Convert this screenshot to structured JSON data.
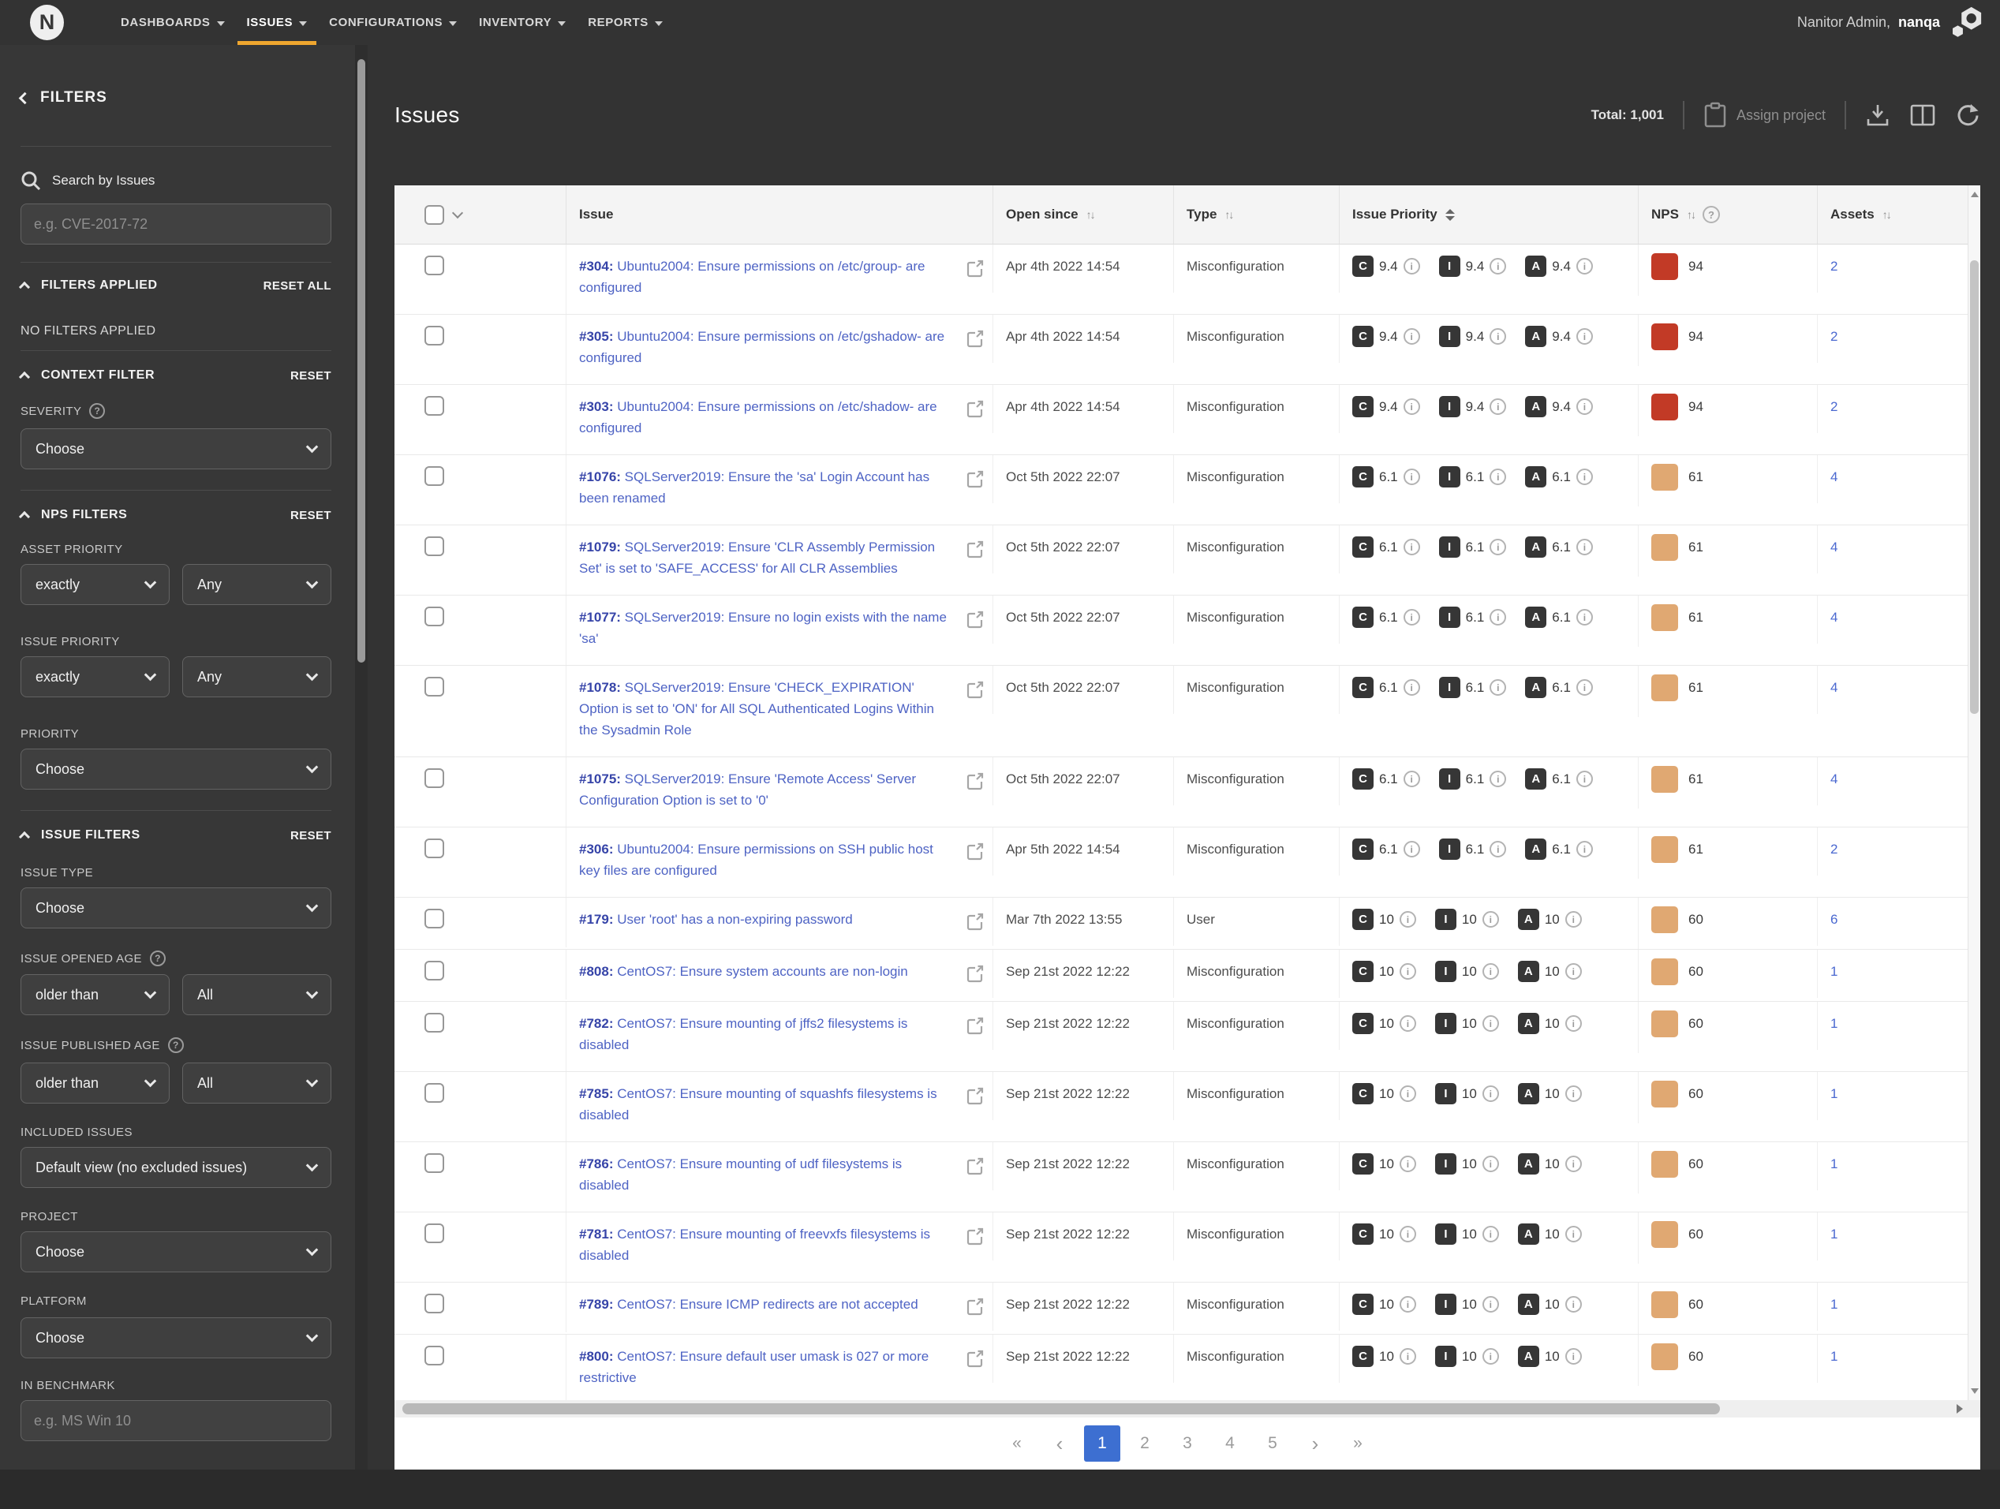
{
  "colors": {
    "accent": "#efa62f",
    "nps_high": "#c23a26",
    "nps_medium": "#e0a872",
    "active_page": "#3d6fd1",
    "link": "#4e63c4"
  },
  "brand": {
    "logo_letter": "N",
    "user_label": "Nanitor Admin,",
    "user_name": "nanqa"
  },
  "nav": {
    "items": [
      {
        "label": "DASHBOARDS",
        "active": false
      },
      {
        "label": "ISSUES",
        "active": true
      },
      {
        "label": "CONFIGURATIONS",
        "active": false
      },
      {
        "label": "INVENTORY",
        "active": false
      },
      {
        "label": "REPORTS",
        "active": false
      }
    ]
  },
  "sidebar": {
    "title": "FILTERS",
    "search_label": "Search by Issues",
    "search_placeholder": "e.g. CVE-2017-72",
    "filters_applied": {
      "title": "FILTERS APPLIED",
      "action": "RESET ALL",
      "empty": "NO FILTERS APPLIED"
    },
    "context_filter": {
      "title": "CONTEXT FILTER",
      "action": "RESET",
      "severity_label": "SEVERITY",
      "severity_value": "Choose"
    },
    "nps_filters": {
      "title": "NPS FILTERS",
      "action": "RESET",
      "asset_priority_label": "ASSET PRIORITY",
      "asset_priority_op": "exactly",
      "asset_priority_value": "Any",
      "issue_priority_label": "ISSUE PRIORITY",
      "issue_priority_op": "exactly",
      "issue_priority_value": "Any",
      "priority_label": "PRIORITY",
      "priority_value": "Choose"
    },
    "issue_filters": {
      "title": "ISSUE FILTERS",
      "action": "RESET",
      "issue_type_label": "ISSUE TYPE",
      "issue_type_value": "Choose",
      "opened_age_label": "ISSUE OPENED AGE",
      "opened_age_op": "older than",
      "opened_age_value": "All",
      "published_age_label": "ISSUE PUBLISHED AGE",
      "published_age_op": "older than",
      "published_age_value": "All",
      "included_label": "INCLUDED ISSUES",
      "included_value": "Default view (no excluded issues)",
      "project_label": "PROJECT",
      "project_value": "Choose",
      "platform_label": "PLATFORM",
      "platform_value": "Choose",
      "benchmark_label": "IN BENCHMARK",
      "benchmark_placeholder": "e.g. MS Win 10"
    }
  },
  "header": {
    "title": "Issues",
    "total_label": "Total: 1,001",
    "assign_label": "Assign project"
  },
  "table": {
    "columns": {
      "issue": "Issue",
      "open_since": "Open since",
      "type": "Type",
      "issue_priority": "Issue Priority",
      "nps": "NPS",
      "assets": "Assets"
    },
    "priority_letters": [
      "C",
      "I",
      "A"
    ],
    "rows": [
      {
        "id": "#304:",
        "title": "Ubuntu2004: Ensure permissions on /etc/group- are configured",
        "open_since": "Apr 4th 2022 14:54",
        "type": "Misconfiguration",
        "priority": "9.4",
        "nps": "94",
        "nps_level": "high",
        "assets": "2"
      },
      {
        "id": "#305:",
        "title": "Ubuntu2004: Ensure permissions on /etc/gshadow- are configured",
        "open_since": "Apr 4th 2022 14:54",
        "type": "Misconfiguration",
        "priority": "9.4",
        "nps": "94",
        "nps_level": "high",
        "assets": "2"
      },
      {
        "id": "#303:",
        "title": "Ubuntu2004: Ensure permissions on /etc/shadow- are configured",
        "open_since": "Apr 4th 2022 14:54",
        "type": "Misconfiguration",
        "priority": "9.4",
        "nps": "94",
        "nps_level": "high",
        "assets": "2"
      },
      {
        "id": "#1076:",
        "title": "SQLServer2019: Ensure the 'sa' Login Account has been renamed",
        "open_since": "Oct 5th 2022 22:07",
        "type": "Misconfiguration",
        "priority": "6.1",
        "nps": "61",
        "nps_level": "medium",
        "assets": "4"
      },
      {
        "id": "#1079:",
        "title": "SQLServer2019: Ensure 'CLR Assembly Permission Set' is set to 'SAFE_ACCESS' for All CLR Assemblies",
        "open_since": "Oct 5th 2022 22:07",
        "type": "Misconfiguration",
        "priority": "6.1",
        "nps": "61",
        "nps_level": "medium",
        "assets": "4"
      },
      {
        "id": "#1077:",
        "title": "SQLServer2019: Ensure no login exists with the name 'sa'",
        "open_since": "Oct 5th 2022 22:07",
        "type": "Misconfiguration",
        "priority": "6.1",
        "nps": "61",
        "nps_level": "medium",
        "assets": "4"
      },
      {
        "id": "#1078:",
        "title": "SQLServer2019: Ensure 'CHECK_EXPIRATION' Option is set to 'ON' for All SQL Authenticated Logins Within the Sysadmin Role",
        "open_since": "Oct 5th 2022 22:07",
        "type": "Misconfiguration",
        "priority": "6.1",
        "nps": "61",
        "nps_level": "medium",
        "assets": "4"
      },
      {
        "id": "#1075:",
        "title": "SQLServer2019: Ensure 'Remote Access' Server Configuration Option is set to '0'",
        "open_since": "Oct 5th 2022 22:07",
        "type": "Misconfiguration",
        "priority": "6.1",
        "nps": "61",
        "nps_level": "medium",
        "assets": "4"
      },
      {
        "id": "#306:",
        "title": "Ubuntu2004: Ensure permissions on SSH public host key files are configured",
        "open_since": "Apr 5th 2022 14:54",
        "type": "Misconfiguration",
        "priority": "6.1",
        "nps": "61",
        "nps_level": "medium",
        "assets": "2"
      },
      {
        "id": "#179:",
        "title": "User 'root' has a non-expiring password",
        "open_since": "Mar 7th 2022 13:55",
        "type": "User",
        "priority": "10",
        "nps": "60",
        "nps_level": "medium",
        "assets": "6"
      },
      {
        "id": "#808:",
        "title": "CentOS7: Ensure system accounts are non-login",
        "open_since": "Sep 21st 2022 12:22",
        "type": "Misconfiguration",
        "priority": "10",
        "nps": "60",
        "nps_level": "medium",
        "assets": "1"
      },
      {
        "id": "#782:",
        "title": "CentOS7: Ensure mounting of jffs2 filesystems is disabled",
        "open_since": "Sep 21st 2022 12:22",
        "type": "Misconfiguration",
        "priority": "10",
        "nps": "60",
        "nps_level": "medium",
        "assets": "1"
      },
      {
        "id": "#785:",
        "title": "CentOS7: Ensure mounting of squashfs filesystems is disabled",
        "open_since": "Sep 21st 2022 12:22",
        "type": "Misconfiguration",
        "priority": "10",
        "nps": "60",
        "nps_level": "medium",
        "assets": "1"
      },
      {
        "id": "#786:",
        "title": "CentOS7: Ensure mounting of udf filesystems is disabled",
        "open_since": "Sep 21st 2022 12:22",
        "type": "Misconfiguration",
        "priority": "10",
        "nps": "60",
        "nps_level": "medium",
        "assets": "1"
      },
      {
        "id": "#781:",
        "title": "CentOS7: Ensure mounting of freevxfs filesystems is disabled",
        "open_since": "Sep 21st 2022 12:22",
        "type": "Misconfiguration",
        "priority": "10",
        "nps": "60",
        "nps_level": "medium",
        "assets": "1"
      },
      {
        "id": "#789:",
        "title": "CentOS7: Ensure ICMP redirects are not accepted",
        "open_since": "Sep 21st 2022 12:22",
        "type": "Misconfiguration",
        "priority": "10",
        "nps": "60",
        "nps_level": "medium",
        "assets": "1"
      },
      {
        "id": "#800:",
        "title": "CentOS7: Ensure default user umask is 027 or more restrictive",
        "open_since": "Sep 21st 2022 12:22",
        "type": "Misconfiguration",
        "priority": "10",
        "nps": "60",
        "nps_level": "medium",
        "assets": "1"
      }
    ]
  },
  "pagination": {
    "pages": [
      "1",
      "2",
      "3",
      "4",
      "5"
    ],
    "active_page": "1"
  }
}
